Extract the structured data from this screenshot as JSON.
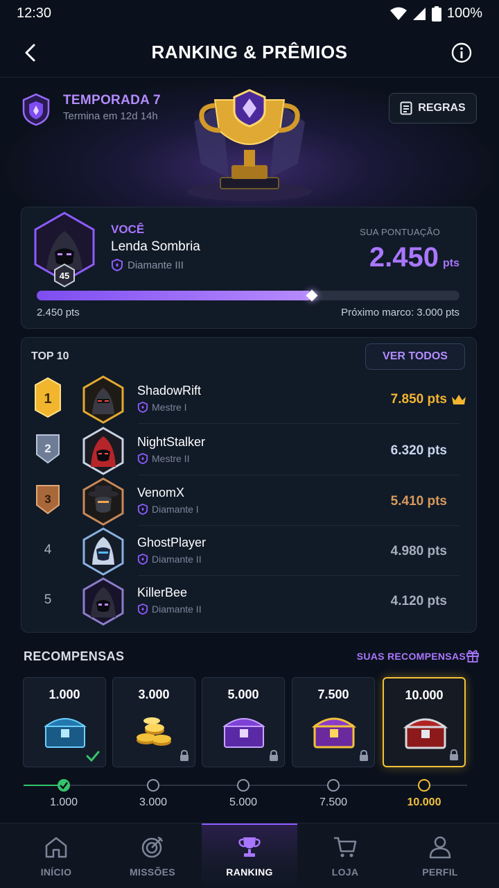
{
  "status_bar": {
    "time": "12:30",
    "battery": "100%"
  },
  "header": {
    "title": "RANKING & PRÊMIOS"
  },
  "season": {
    "title": "TEMPORADA 7",
    "subtitle": "Termina em 12d 14h",
    "rules_label": "REGRAS"
  },
  "you": {
    "label": "VOCÊ",
    "name": "Lenda Sombria",
    "tier": "Diamante III",
    "level": "45",
    "score_label": "SUA PONTUAÇÃO",
    "score": "2.450",
    "score_unit": "pts",
    "progress_fraction": 0.65,
    "progress_current": "2.450 pts",
    "progress_next": "Próximo marco: 3.000 pts"
  },
  "top10": {
    "title": "TOP 10",
    "see_all": "VER TODOS",
    "players": [
      {
        "pos": "1",
        "name": "ShadowRift",
        "tier": "Mestre I",
        "score": "7.850 pts",
        "color": "#f3b52f"
      },
      {
        "pos": "2",
        "name": "NightStalker",
        "tier": "Mestre II",
        "score": "6.320 pts",
        "color": "#c9d6ef"
      },
      {
        "pos": "3",
        "name": "VenomX",
        "tier": "Diamante I",
        "score": "5.410 pts",
        "color": "#d89a5d"
      },
      {
        "pos": "4",
        "name": "GhostPlayer",
        "tier": "Diamante II",
        "score": "4.980 pts",
        "color": "#a7afbf"
      },
      {
        "pos": "5",
        "name": "KillerBee",
        "tier": "Diamante II",
        "score": "4.120 pts",
        "color": "#a7afbf"
      }
    ]
  },
  "rewards": {
    "title": "RECOMPENSAS",
    "link": "SUAS RECOMPENSAS",
    "items": [
      {
        "pts": "1.000",
        "label": "1.000",
        "state": "claimed"
      },
      {
        "pts": "3.000",
        "label": "3.000",
        "state": "locked"
      },
      {
        "pts": "5.000",
        "label": "5.000",
        "state": "locked"
      },
      {
        "pts": "7.500",
        "label": "7.500",
        "state": "locked"
      },
      {
        "pts": "10.000",
        "label": "10.000",
        "state": "locked"
      }
    ]
  },
  "nav": [
    {
      "label": "INÍCIO",
      "icon": "home-icon"
    },
    {
      "label": "MISSÕES",
      "icon": "target-icon"
    },
    {
      "label": "RANKING",
      "icon": "trophy-icon",
      "active": true
    },
    {
      "label": "LOJA",
      "icon": "cart-icon"
    },
    {
      "label": "PERFIL",
      "icon": "user-icon"
    }
  ],
  "colors": {
    "accent": "#a977ff",
    "gold": "#f3b52f",
    "success": "#35c46a",
    "background": "#0b111c"
  }
}
